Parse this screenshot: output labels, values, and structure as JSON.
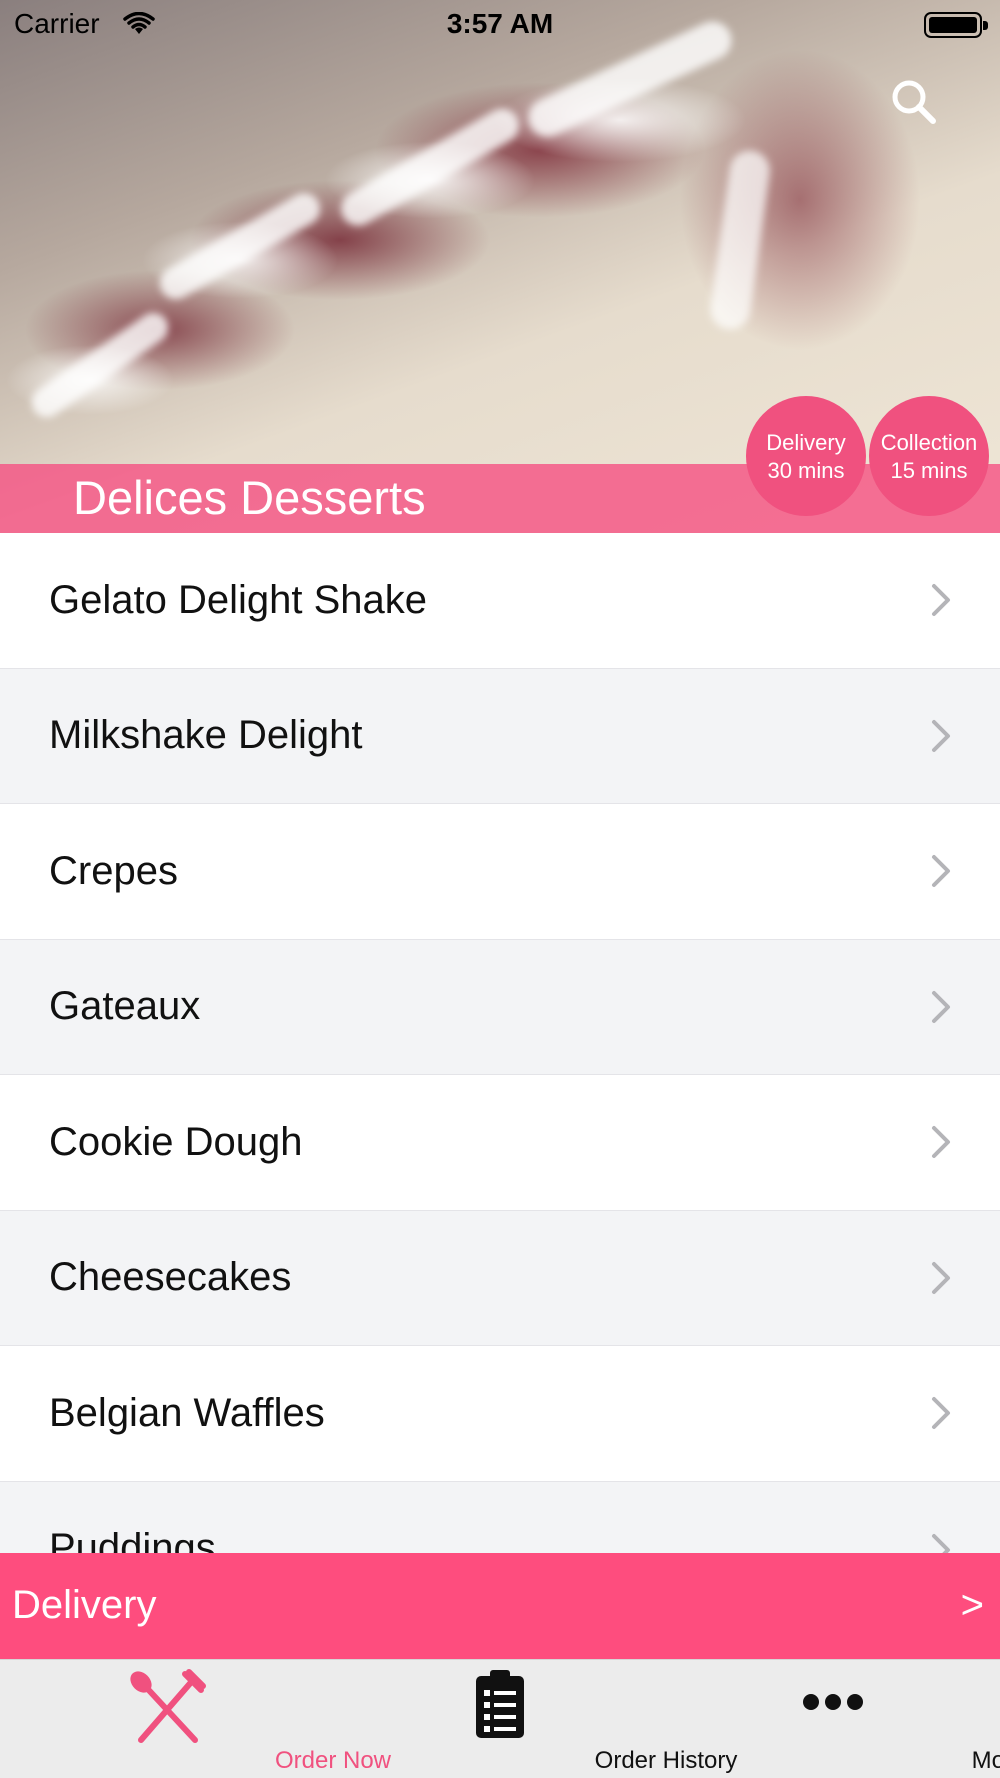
{
  "status_bar": {
    "carrier": "Carrier",
    "time": "3:57 AM"
  },
  "header": {
    "store_name": "Delices Desserts",
    "badges": {
      "delivery": {
        "label": "Delivery",
        "time": "30 mins"
      },
      "collection": {
        "label": "Collection",
        "time": "15 mins"
      }
    },
    "search_icon": "search-icon"
  },
  "menu": {
    "items": [
      {
        "label": "Gelato Delight Shake"
      },
      {
        "label": "Milkshake Delight"
      },
      {
        "label": "Crepes"
      },
      {
        "label": "Gateaux"
      },
      {
        "label": "Cookie Dough"
      },
      {
        "label": "Cheesecakes"
      },
      {
        "label": "Belgian Waffles"
      },
      {
        "label": "Puddings"
      }
    ]
  },
  "delivery_bar": {
    "label": "Delivery",
    "arrow": ">"
  },
  "tab_bar": {
    "tabs": [
      {
        "label": "Order Now",
        "icon": "fork-knife-icon",
        "active": true
      },
      {
        "label": "Order History",
        "icon": "clipboard-list-icon",
        "active": false
      },
      {
        "label": "More",
        "icon": "more-dots-icon",
        "active": false
      }
    ]
  },
  "colors": {
    "accent": "#fe4d7e",
    "badge": "#f0517f",
    "row_alt": "#f3f4f6",
    "tab_bar": "#ececec"
  }
}
